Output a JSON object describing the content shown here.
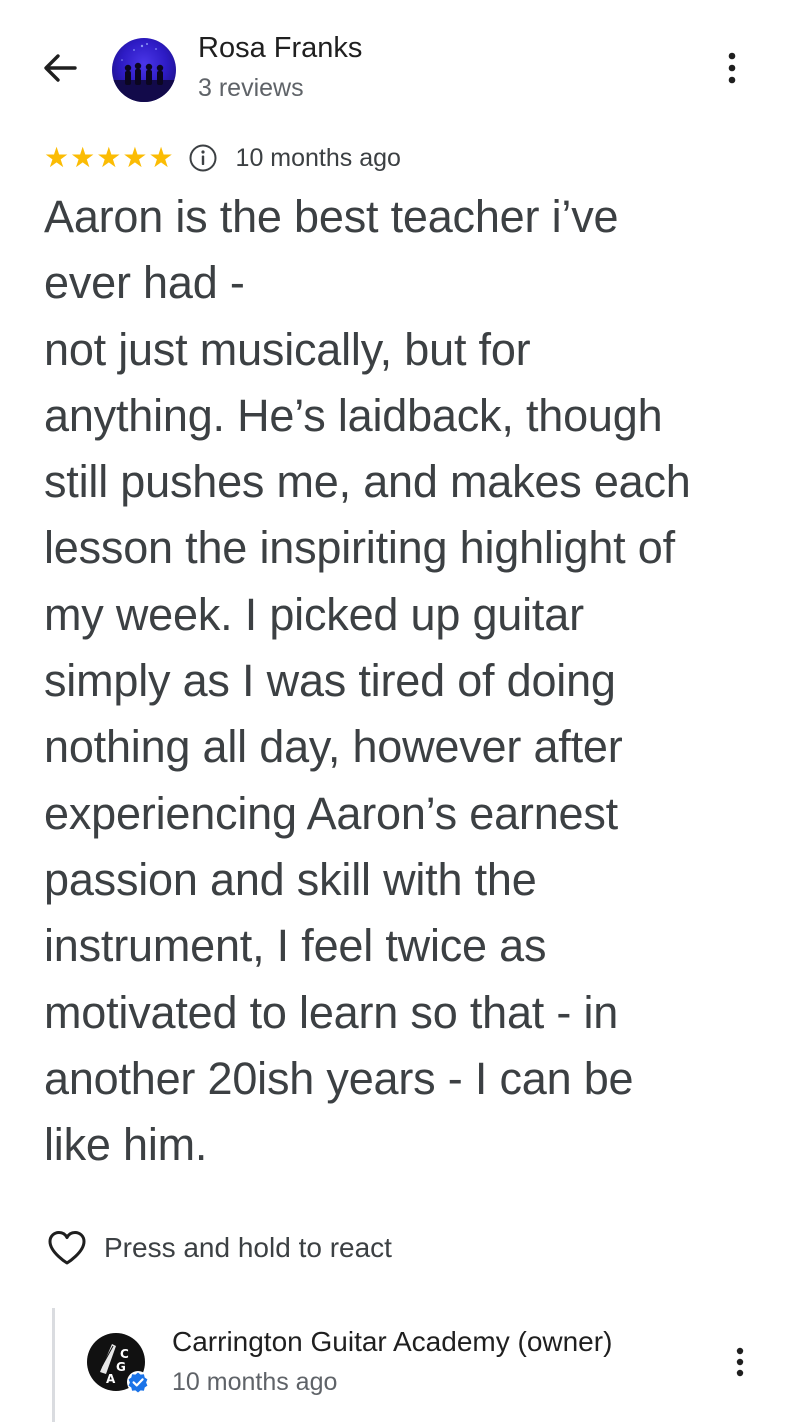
{
  "header": {
    "back_icon": "arrow-back-icon",
    "reviewer_name": "Rosa Franks",
    "review_count": "3 reviews",
    "more_icon": "more-vert-icon"
  },
  "review": {
    "rating": 5,
    "rating_max": 5,
    "star_color": "#fbbc04",
    "info_icon": "info-icon",
    "date": "10 months ago",
    "text_lines": [
      "Aaron is the best teacher i’ve",
      "ever had -",
      "not just musically, but for",
      "anything. He’s laidback, though",
      "still pushes me, and makes each",
      "lesson the inspiriting highlight of",
      "my week. I picked up guitar",
      "simply as I was tired of doing",
      "nothing all day, however after",
      "experiencing Aaron’s earnest",
      "passion and skill with the",
      "instrument, I feel twice as",
      "motivated to learn so that - in",
      "another 20ish years -  I can be",
      "like him."
    ]
  },
  "reaction": {
    "icon": "heart-outline-icon",
    "label": "Press and hold to react"
  },
  "owner_reply": {
    "name": "Carrington Guitar Academy (owner)",
    "date": "10 months ago",
    "avatar_logo_text": "CGA",
    "verified_icon": "verified-badge-icon",
    "verified_color": "#1a73e8",
    "more_icon": "more-vert-icon"
  }
}
